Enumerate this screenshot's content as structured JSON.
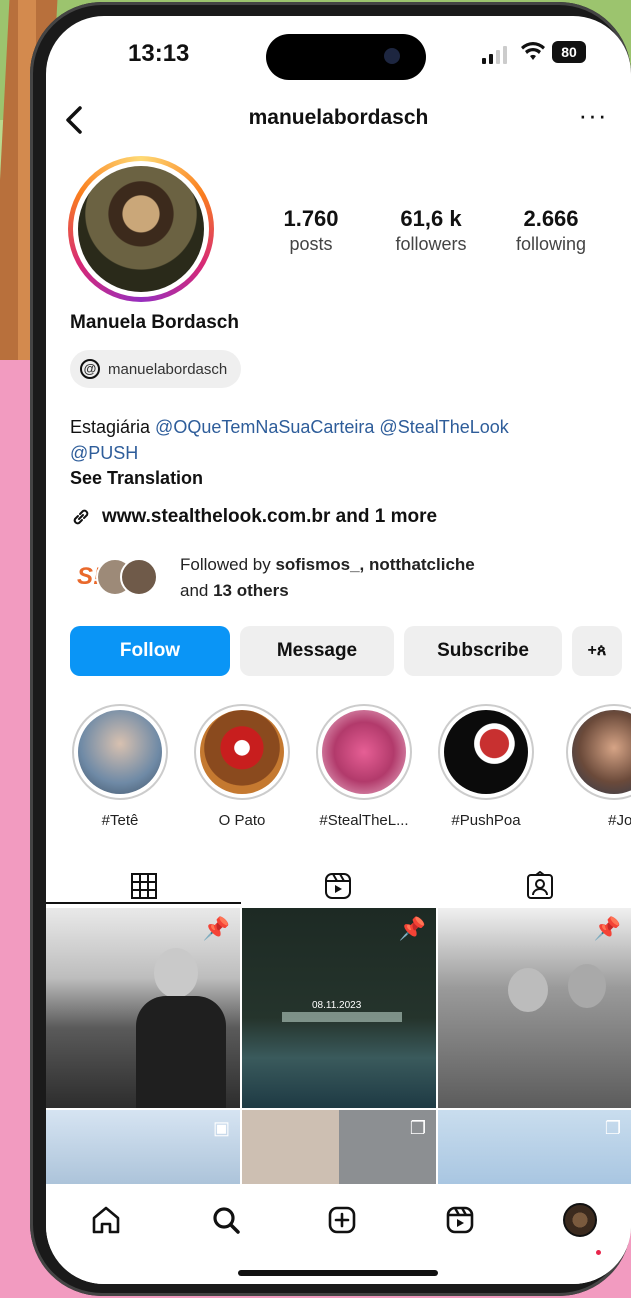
{
  "status_bar": {
    "time": "13:13",
    "battery": "80"
  },
  "profile": {
    "username": "manuelabordasch",
    "full_name": "Manuela Bordasch",
    "threads_handle": "manuelabordasch",
    "stats": [
      {
        "value": "1.760",
        "label": "posts"
      },
      {
        "value": "61,6 k",
        "label": "followers"
      },
      {
        "value": "2.666",
        "label": "following"
      }
    ],
    "bio": {
      "prefix": "Estagiária ",
      "mention1": "@OQueTemNaSuaCarteira",
      "mention2": "@StealTheLook",
      "mention3": "@PUSH"
    },
    "see_translation": "See Translation",
    "link": "www.stealthelook.com.br and 1 more",
    "followed_by": {
      "prefix": "Followed by ",
      "names": "sofismos_, notthatcliche",
      "and_word": "and ",
      "others": "13 others",
      "badge": "S!"
    }
  },
  "buttons": {
    "follow": "Follow",
    "message": "Message",
    "subscribe": "Subscribe",
    "add_user": "+ጰ"
  },
  "highlights": [
    {
      "label": "#Tetê"
    },
    {
      "label": "O Pato"
    },
    {
      "label": "#StealTheL..."
    },
    {
      "label": "#PushPoa"
    },
    {
      "label": "#Jojo"
    }
  ],
  "grid_overlay": {
    "date_text": "08.11.2023"
  },
  "colors": {
    "follow_button": "#0a95f6",
    "mention": "#2e5d9a",
    "notification_dot": "#e8254b"
  },
  "icons": [
    "back-icon",
    "more-icon",
    "threads-icon",
    "link-icon",
    "grid-icon",
    "reels-icon",
    "tagged-icon",
    "home-icon",
    "search-icon",
    "create-icon",
    "reels-nav-icon",
    "profile-nav-icon"
  ]
}
